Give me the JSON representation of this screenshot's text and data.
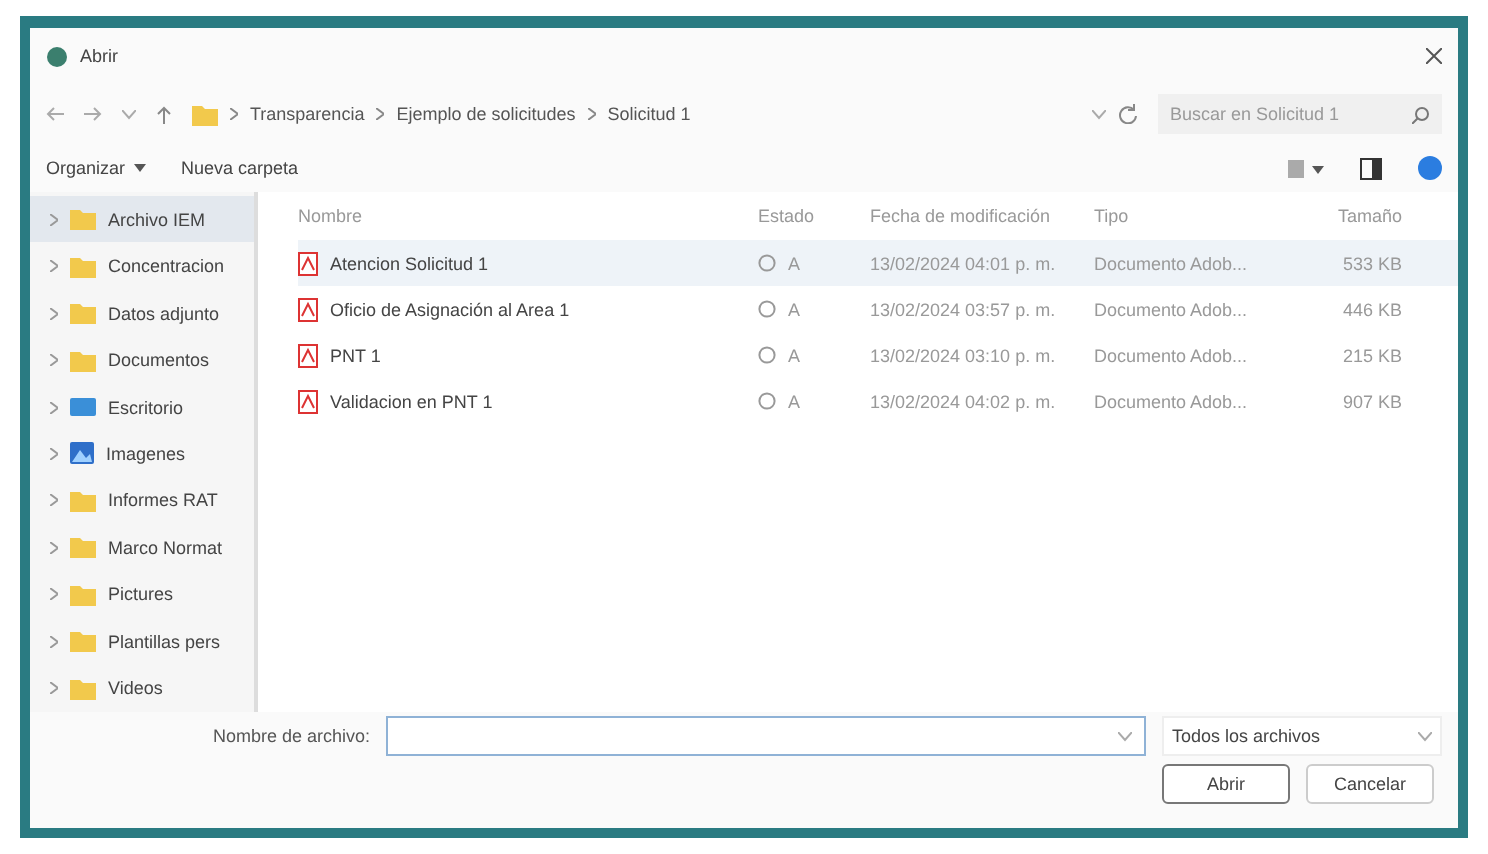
{
  "window": {
    "title": "Abrir"
  },
  "address": {
    "path": [
      {
        "label": "Transparencia"
      },
      {
        "label": "Ejemplo de solicitudes"
      },
      {
        "label": "Solicitud 1"
      }
    ],
    "search_placeholder": "Buscar en Solicitud 1"
  },
  "toolbar": {
    "organize": "Organizar",
    "new_folder": "Nueva carpeta"
  },
  "sidebar": {
    "items": [
      {
        "label": "Archivo IEM",
        "kind": "folder",
        "selected": true
      },
      {
        "label": "Concentracion",
        "kind": "folder",
        "selected": false
      },
      {
        "label": "Datos adjunto",
        "kind": "folder",
        "selected": false
      },
      {
        "label": "Documentos",
        "kind": "folder",
        "selected": false
      },
      {
        "label": "Escritorio",
        "kind": "desktop",
        "selected": false
      },
      {
        "label": "Imagenes",
        "kind": "images",
        "selected": false
      },
      {
        "label": "Informes RAT",
        "kind": "folder",
        "selected": false
      },
      {
        "label": "Marco Normat",
        "kind": "folder",
        "selected": false
      },
      {
        "label": "Pictures",
        "kind": "folder",
        "selected": false
      },
      {
        "label": "Plantillas pers",
        "kind": "folder",
        "selected": false
      },
      {
        "label": "Videos",
        "kind": "folder",
        "selected": false
      }
    ]
  },
  "table": {
    "columns": [
      "Nombre",
      "Estado",
      "Fecha de modificación",
      "Tipo",
      "Tamaño"
    ],
    "rows": [
      {
        "name": "Atencion Solicitud 1",
        "status": "A",
        "modified": "13/02/2024 04:01 p. m.",
        "type": "Documento Adob...",
        "size": "533 KB",
        "selected": true
      },
      {
        "name": "Oficio de Asignación al Area 1",
        "status": "A",
        "modified": "13/02/2024 03:57 p. m.",
        "type": "Documento Adob...",
        "size": "446 KB",
        "selected": false
      },
      {
        "name": "PNT 1",
        "status": "A",
        "modified": "13/02/2024 03:10 p. m.",
        "type": "Documento Adob...",
        "size": "215 KB",
        "selected": false
      },
      {
        "name": "Validacion en PNT 1",
        "status": "A",
        "modified": "13/02/2024 04:02 p. m.",
        "type": "Documento Adob...",
        "size": "907 KB",
        "selected": false
      }
    ]
  },
  "footer": {
    "filename_label": "Nombre de archivo:",
    "filter": "Todos los archivos",
    "buttons": [
      "Abrir",
      "Cancelar"
    ]
  }
}
